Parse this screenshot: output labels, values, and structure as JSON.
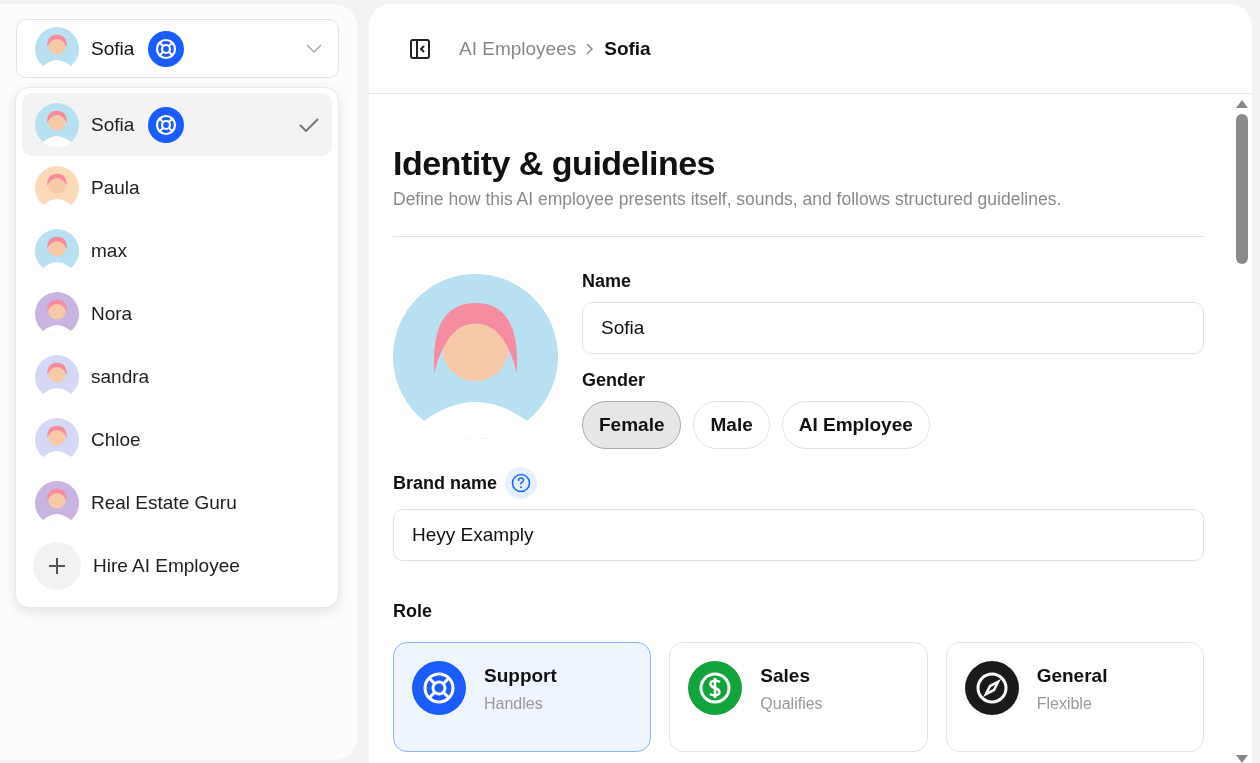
{
  "employee_selector": {
    "name": "Sofia",
    "color": "#b8e0f0",
    "badge": true
  },
  "employee_menu": {
    "items": [
      {
        "name": "Sofia",
        "color": "#b8e0f0",
        "badge": true,
        "selected": true
      },
      {
        "name": "Paula",
        "color": "#fcd9b8",
        "badge": false,
        "selected": false
      },
      {
        "name": "max",
        "color": "#b8e0f0",
        "badge": false,
        "selected": false
      },
      {
        "name": "Nora",
        "color": "#c9b3e0",
        "badge": false,
        "selected": false
      },
      {
        "name": "sandra",
        "color": "#d4d8f5",
        "badge": false,
        "selected": false
      },
      {
        "name": "Chloe",
        "color": "#d4d8f5",
        "badge": false,
        "selected": false
      },
      {
        "name": "Real Estate Guru",
        "color": "#c9b3e0",
        "badge": false,
        "selected": false
      }
    ],
    "hire_label": "Hire AI Employee"
  },
  "breadcrumb": [
    "AI Employees",
    "Sofia"
  ],
  "section": {
    "title": "Identity & guidelines",
    "subtitle": "Define how this AI employee presents itself, sounds, and follows structured guidelines."
  },
  "name_field": {
    "label": "Name",
    "value": "Sofia"
  },
  "gender": {
    "label": "Gender",
    "options": [
      {
        "label": "Female",
        "selected": true
      },
      {
        "label": "Male",
        "selected": false
      },
      {
        "label": "AI Employee",
        "selected": false
      }
    ]
  },
  "brand_name": {
    "label": "Brand name",
    "value": "Heyy Examply"
  },
  "role": {
    "label": "Role",
    "options": [
      {
        "kind": "support",
        "title": "Support",
        "description": "Handles",
        "color": "#1a5cff",
        "selected": true
      },
      {
        "kind": "sales",
        "title": "Sales",
        "description": "Qualifies",
        "color": "#12a33c",
        "selected": false
      },
      {
        "kind": "general",
        "title": "General",
        "description": "Flexible",
        "color": "#1a1a1a",
        "selected": false
      }
    ]
  }
}
